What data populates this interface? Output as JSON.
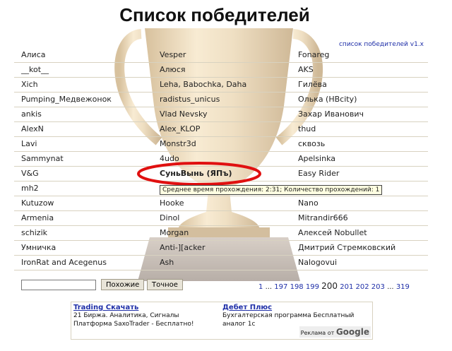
{
  "header": {
    "title": "Список победителей",
    "version_link": "список победителей v1.x"
  },
  "winners": [
    [
      "Алиса",
      "Vesper",
      "Fonareg"
    ],
    [
      "__kot__",
      "Алюся",
      "AKS"
    ],
    [
      "Xich",
      "Leha, Babochka, Daha",
      "Гилёва"
    ],
    [
      "Pumping_Медвежонок",
      "radistus_unicus",
      "Олька (НВcity)"
    ],
    [
      "ankis",
      "Vlad Nevsky",
      "Захар Иванович"
    ],
    [
      "AlexN",
      "Alex_KLOP",
      "thud"
    ],
    [
      "Lavi",
      "Monstr3d",
      "сквозь"
    ],
    [
      "Sammynat",
      "4udo",
      "Apelsinka"
    ],
    [
      "V&G",
      "СуньВынь (ЯПъ)",
      "Easy Rider"
    ],
    [
      "mh2",
      "",
      ""
    ],
    [
      "Kutuzow",
      "Hooke",
      "Nano"
    ],
    [
      "Armenia",
      "Dinol",
      "Mitrandir666"
    ],
    [
      "schizik",
      "Morgan",
      "Алексей Nobullet"
    ],
    [
      "Умничка",
      "Anti-][acker",
      "Дмитрий Стремковский"
    ],
    [
      "IronRat and Acegenus",
      "Ash",
      "Nalogovui"
    ]
  ],
  "tooltip": "Среднее время прохождения: 2:31; Количество прохождений: 1",
  "search": {
    "value": "",
    "similar_label": "Похожие",
    "exact_label": "Точное"
  },
  "pagination": {
    "first": "1",
    "ellipsis": "...",
    "pages": [
      "197",
      "198",
      "199"
    ],
    "current": "200",
    "after": [
      "201",
      "202",
      "203"
    ],
    "last": "319"
  },
  "ads": [
    {
      "title": "Trading Скачать",
      "text": "21 Биржа. Аналитика, Сигналы Платформа SaxoTrader - Бесплатно!"
    },
    {
      "title": "Дебет Плюс",
      "text": "Бухгалтерская программа Бесплатный аналог 1с"
    }
  ],
  "ad_label": {
    "prefix": "Реклама от",
    "brand": "Google"
  },
  "colors": {
    "link": "#1f2fa8",
    "highlight_oval": "#e01010",
    "trophy": "#c9a86a"
  }
}
